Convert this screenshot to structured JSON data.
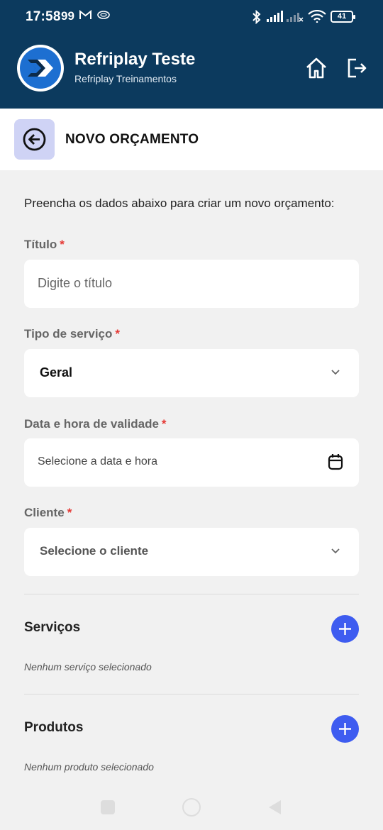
{
  "status": {
    "time": "17:58",
    "extra": "99",
    "battery": "41"
  },
  "app": {
    "title": "Refriplay Teste",
    "subtitle": "Refriplay Treinamentos"
  },
  "page": {
    "title": "NOVO ORÇAMENTO",
    "intro": "Preencha os dados abaixo para criar um novo orçamento:"
  },
  "form": {
    "titulo": {
      "label": "Título",
      "required": "*",
      "placeholder": "Digite o título"
    },
    "tipo": {
      "label": "Tipo de serviço",
      "required": "*",
      "value": "Geral"
    },
    "validade": {
      "label": "Data e hora de validade",
      "required": "*",
      "placeholder": "Selecione a data e hora"
    },
    "cliente": {
      "label": "Cliente",
      "required": "*",
      "placeholder": "Selecione o cliente"
    }
  },
  "servicos": {
    "title": "Serviços",
    "empty": "Nenhum serviço selecionado"
  },
  "produtos": {
    "title": "Produtos",
    "empty": "Nenhum produto selecionado"
  },
  "colors": {
    "header": "#0c3a5e",
    "accent": "#3e5cf0",
    "back_button_bg": "#cfd3f5",
    "required": "#e53935"
  },
  "icons": [
    "home-icon",
    "logout-icon",
    "back-arrow-icon",
    "chevron-down-icon",
    "calendar-icon",
    "plus-icon"
  ]
}
